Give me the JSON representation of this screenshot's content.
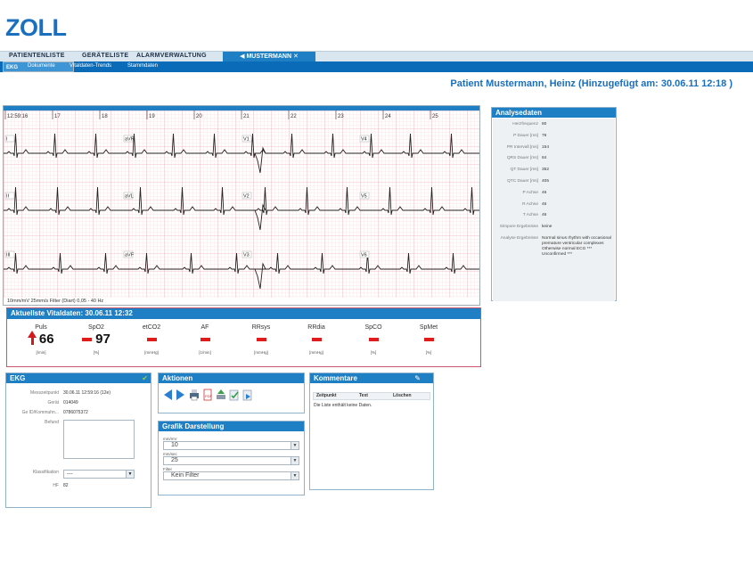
{
  "brand": {
    "logo": "ZOLL",
    "accent": "#1f7fc4"
  },
  "nav": {
    "items": [
      "PATIENTENLISTE",
      "GERÄTELISTE",
      "ALARMVERWALTUNG"
    ],
    "active": "MUSTERMANN"
  },
  "subnav": {
    "items": [
      "EKG",
      "Dokumente",
      "Vitaldaten-Trends",
      "Stammdaten"
    ]
  },
  "patient_header": "Patient Mustermann, Heinz (Hinzugefügt am: 30.06.11 12:18 )",
  "ecg": {
    "time_labels": [
      "12:59:16",
      "17",
      "18",
      "19",
      "20",
      "21",
      "22",
      "23",
      "24",
      "25"
    ],
    "leads": [
      {
        "left": "I",
        "mid": "aVR",
        "right1": "V1",
        "right2": "V4"
      },
      {
        "left": "II",
        "mid": "aVL",
        "right1": "V2",
        "right2": "V5"
      },
      {
        "left": "III",
        "mid": "aVF",
        "right1": "V3",
        "right2": "V6"
      }
    ],
    "footer": "10mm/mV  25mm/s  Filter (Diart)  0,05 - 40 Hz"
  },
  "analysis": {
    "title": "Analysedaten",
    "rows": [
      {
        "k": "Herzfrequenz",
        "v": "80"
      },
      {
        "k": "P Dauer [ms]",
        "v": "76"
      },
      {
        "k": "PR Intervall [ms]",
        "v": "154"
      },
      {
        "k": "QRS Dauer [ms]",
        "v": "84"
      },
      {
        "k": "QT Dauer [ms]",
        "v": "352"
      },
      {
        "k": "QTC Dauer [ms]",
        "v": "405"
      },
      {
        "k": "P Achse",
        "v": "46"
      },
      {
        "k": "R Achse",
        "v": "46"
      },
      {
        "k": "T Achse",
        "v": "46"
      },
      {
        "k": "Simpore Ergebnisse",
        "v": "keine"
      },
      {
        "k": "Analyse Ergebnisse",
        "v": "Normal sinus rhythm with occasional premature ventricular complexes Otherwise normal ECG *** Unconfirmed ***"
      }
    ]
  },
  "vitals": {
    "title": "Aktuellste Vitaldaten: 30.06.11 12:32",
    "items": [
      {
        "label": "Puls",
        "value": "66",
        "unit": "[/min]",
        "trend": "up"
      },
      {
        "label": "SpO2",
        "value": "97",
        "unit": "[%]"
      },
      {
        "label": "etCO2",
        "value": "",
        "unit": "[mmHg]"
      },
      {
        "label": "AF",
        "value": "",
        "unit": "[1/min]"
      },
      {
        "label": "RRsys",
        "value": "",
        "unit": "[mmHg]"
      },
      {
        "label": "RRdia",
        "value": "",
        "unit": "[mmHg]"
      },
      {
        "label": "SpCO",
        "value": "",
        "unit": "[%]"
      },
      {
        "label": "SpMet",
        "value": "",
        "unit": "[%]"
      }
    ]
  },
  "ekg": {
    "title": "EKG",
    "fields": [
      {
        "k": "Messzeitpunkt",
        "v": "30.06.11 12:59:16 (12e)"
      },
      {
        "k": "Gerät",
        "v": "014049"
      },
      {
        "k": "Ge ID/Kommuhn...",
        "v": "0786075372"
      }
    ],
    "befund_label": "Befund",
    "klassifikation_label": "Klassifikation",
    "klassifikation_value": "----",
    "hf_label": "HF",
    "hf_value": "82"
  },
  "actions": {
    "title": "Aktionen"
  },
  "grafik": {
    "title": "Grafik Darstellung",
    "fields": [
      {
        "label": "mm/mV",
        "value": "10"
      },
      {
        "label": "mm/sec",
        "value": "25"
      },
      {
        "label": "Filter",
        "value": "Kein Filter"
      }
    ]
  },
  "comments": {
    "title": "Kommentare",
    "columns": [
      "Zeitpunkt",
      "Text",
      "Löschen"
    ],
    "empty": "Die Liste enthält keine Daten."
  }
}
